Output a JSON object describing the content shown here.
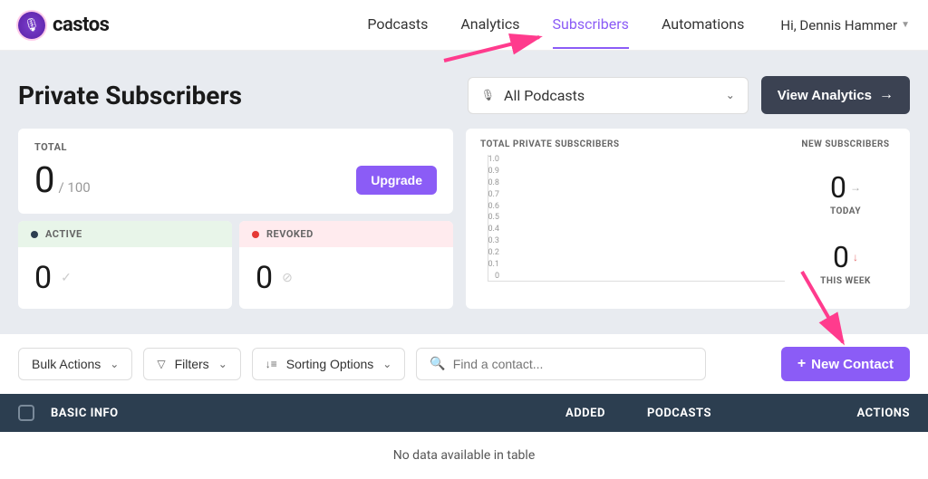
{
  "brand": {
    "name": "castos"
  },
  "nav": {
    "items": [
      {
        "label": "Podcasts",
        "active": false
      },
      {
        "label": "Analytics",
        "active": false
      },
      {
        "label": "Subscribers",
        "active": true
      },
      {
        "label": "Automations",
        "active": false
      }
    ]
  },
  "user": {
    "greeting": "Hi, Dennis Hammer"
  },
  "page": {
    "title": "Private Subscribers"
  },
  "podcast_selector": {
    "icon": "microphone-icon",
    "text": "All Podcasts"
  },
  "buttons": {
    "view_analytics": "View Analytics",
    "upgrade": "Upgrade",
    "bulk_actions": "Bulk Actions",
    "filters": "Filters",
    "sorting": "Sorting Options",
    "new_contact": "New Contact"
  },
  "cards": {
    "total": {
      "label": "TOTAL",
      "value": "0",
      "limit": "/ 100"
    },
    "active": {
      "label": "ACTIVE",
      "value": "0"
    },
    "revoked": {
      "label": "REVOKED",
      "value": "0"
    }
  },
  "chart_data": {
    "type": "line",
    "title": "TOTAL PRIVATE SUBSCRIBERS",
    "categories": [],
    "values": [],
    "xlabel": "",
    "ylabel": "",
    "ylim": [
      0,
      1.0
    ],
    "y_ticks": [
      "1.0",
      "0.9",
      "0.8",
      "0.7",
      "0.6",
      "0.5",
      "0.4",
      "0.3",
      "0.2",
      "0.1",
      "0"
    ]
  },
  "new_subscribers": {
    "title": "NEW SUBSCRIBERS",
    "today": {
      "value": "0",
      "label": "TODAY"
    },
    "week": {
      "value": "0",
      "label": "THIS WEEK"
    }
  },
  "search": {
    "placeholder": "Find a contact..."
  },
  "table": {
    "columns": {
      "basic": "BASIC INFO",
      "added": "ADDED",
      "podcasts": "PODCASTS",
      "actions": "ACTIONS"
    },
    "empty": "No data available in table"
  }
}
